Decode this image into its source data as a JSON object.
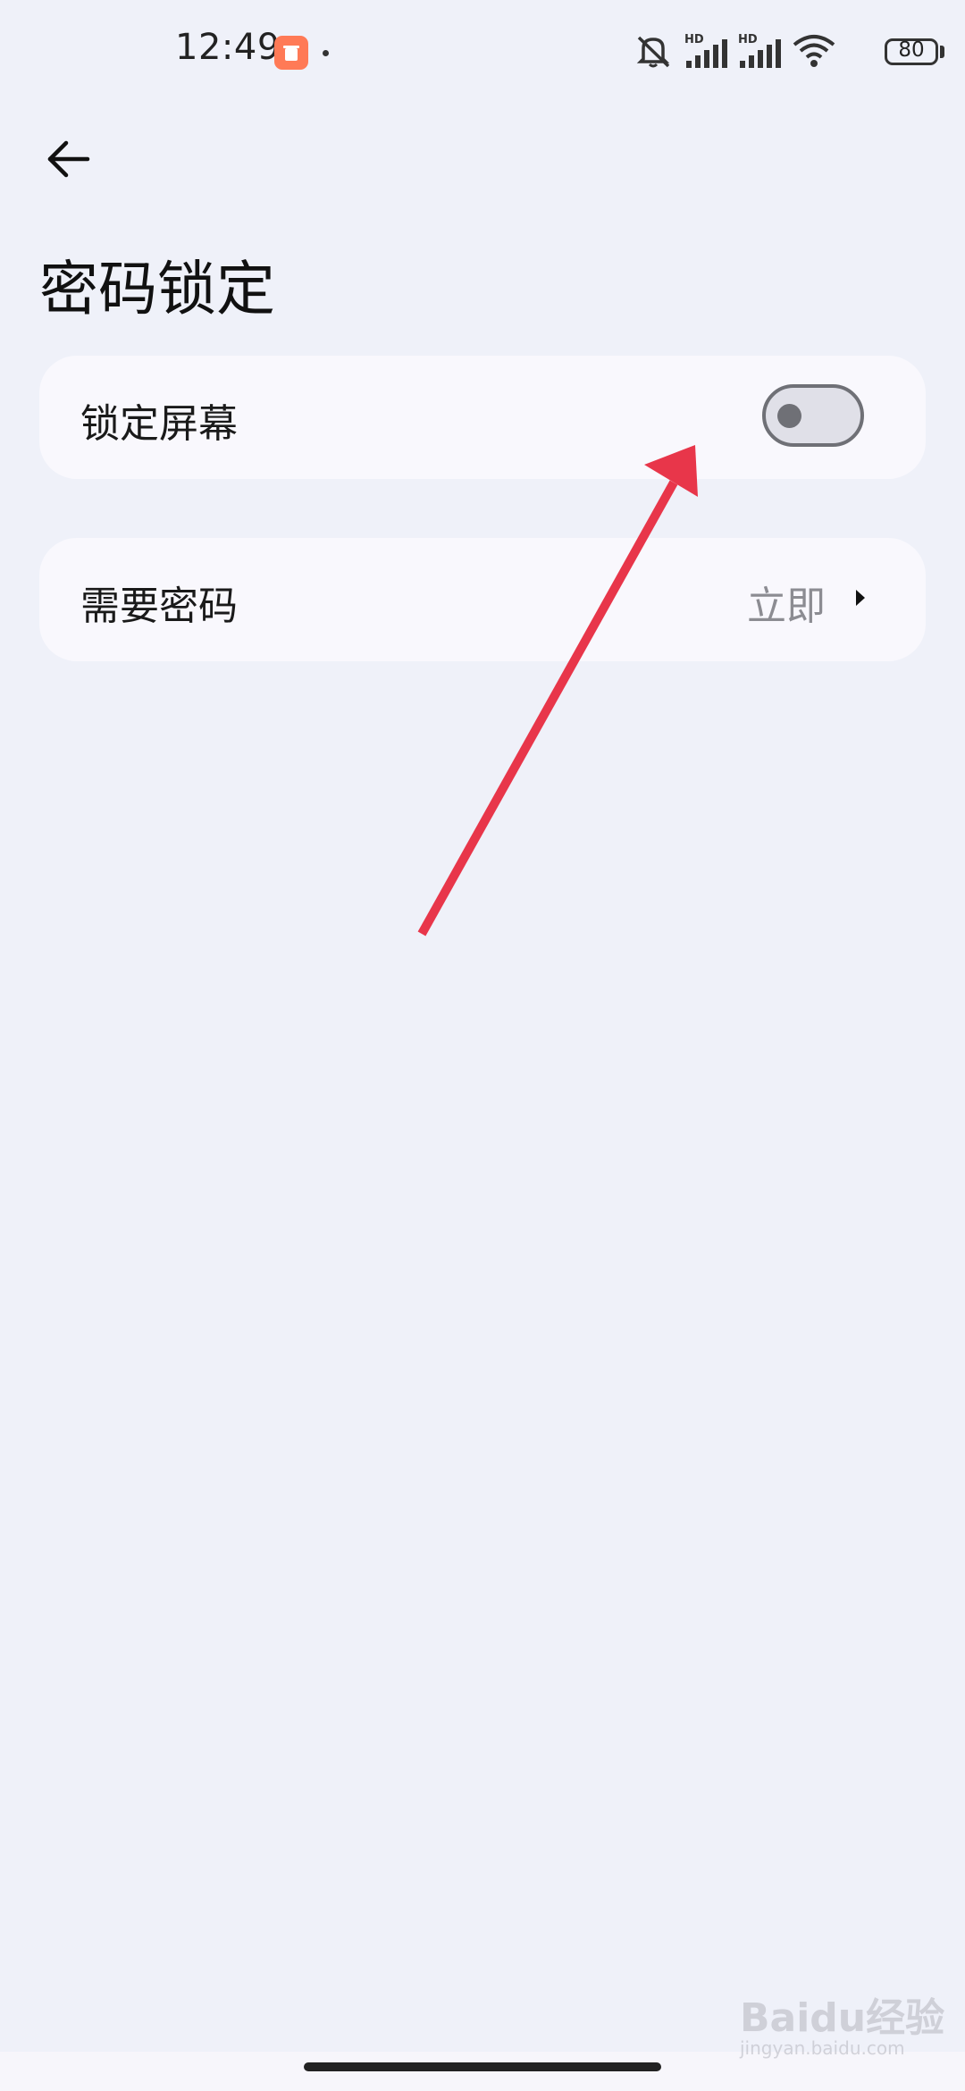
{
  "status_bar": {
    "time": "12:49",
    "battery_level": "80",
    "icons": [
      "app-notification-icon",
      "silent-icon",
      "hd-signal-icon",
      "hd-signal-icon",
      "wifi-icon",
      "battery-icon"
    ]
  },
  "header": {
    "back_icon": "arrow-left-icon",
    "title": "密码锁定"
  },
  "settings": {
    "lock_screen": {
      "label": "锁定屏幕",
      "enabled": false
    },
    "require_password": {
      "label": "需要密码",
      "value": "立即"
    }
  },
  "annotation": {
    "color": "#e8364a"
  },
  "watermark": {
    "text": "Baidu经验",
    "sub": "jingyan.baidu.com"
  }
}
